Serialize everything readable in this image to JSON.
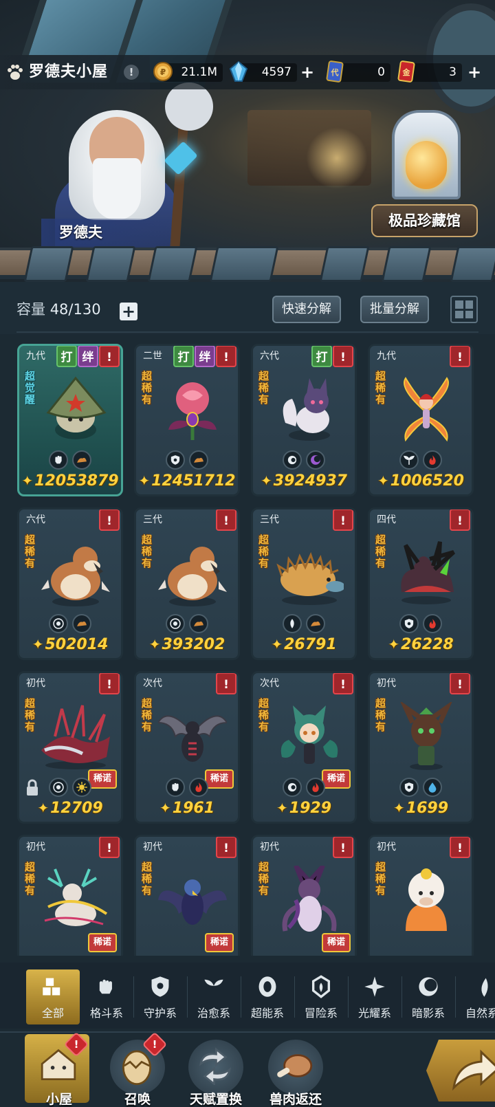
{
  "header": {
    "title": "罗德夫小屋",
    "info_label": "!",
    "npc_name": "罗德夫",
    "gallery_button": "极品珍藏馆"
  },
  "resources": [
    {
      "name": "coin-icon",
      "value": "21.1M",
      "has_plus": false,
      "color": "#e3a53a"
    },
    {
      "name": "crystal-icon",
      "value": "4597",
      "has_plus": true,
      "color": "#4fb3e8"
    },
    {
      "name": "ticket-card-icon",
      "value": "0",
      "has_plus": false,
      "color": "#3a5fc8"
    },
    {
      "name": "gold-card-icon",
      "value": "3",
      "has_plus": true,
      "color": "#c8262b"
    }
  ],
  "toolbar": {
    "capacity_label": "容量",
    "capacity_value": "48/130",
    "add_label": "+",
    "quick_decompose": "快速分解",
    "batch_decompose": "批量分解"
  },
  "monsters": [
    {
      "gen": "九代",
      "rarity": "超觉醒",
      "awake": true,
      "tags": [
        "打",
        "绊",
        "!"
      ],
      "elements": [
        "fist-icon",
        "earth-icon"
      ],
      "power": "12053879",
      "sprite": "mushroom-wizard",
      "color": "#7c8c5e"
    },
    {
      "gen": "二世",
      "rarity": "超稀有",
      "awake": false,
      "tags": [
        "打",
        "绊",
        "!"
      ],
      "elements": [
        "shield-icon",
        "earth-icon"
      ],
      "power": "12451712",
      "sprite": "rose",
      "color": "#e0607e"
    },
    {
      "gen": "六代",
      "rarity": "超稀有",
      "awake": false,
      "tags": [
        "打",
        "!"
      ],
      "elements": [
        "eye-icon",
        "moon-icon"
      ],
      "power": "3924937",
      "sprite": "fox",
      "color": "#5a4a7a"
    },
    {
      "gen": "九代",
      "rarity": "超稀有",
      "awake": false,
      "tags": [
        "!"
      ],
      "elements": [
        "leaf-icon",
        "fire-icon"
      ],
      "power": "1006520",
      "sprite": "fairy",
      "color": "#f0843a"
    },
    {
      "gen": "六代",
      "rarity": "超稀有",
      "awake": false,
      "tags": [
        "!"
      ],
      "elements": [
        "target-icon",
        "earth-icon"
      ],
      "power": "502014",
      "sprite": "mole",
      "color": "#c27a46"
    },
    {
      "gen": "三代",
      "rarity": "超稀有",
      "awake": false,
      "tags": [
        "!"
      ],
      "elements": [
        "target-icon",
        "earth-icon"
      ],
      "power": "393202",
      "sprite": "mole",
      "color": "#c27a46"
    },
    {
      "gen": "三代",
      "rarity": "超稀有",
      "awake": false,
      "tags": [
        "!"
      ],
      "elements": [
        "wind-icon",
        "earth-icon"
      ],
      "power": "26791",
      "sprite": "echidna",
      "color": "#d9a150"
    },
    {
      "gen": "四代",
      "rarity": "超稀有",
      "awake": false,
      "tags": [
        "!"
      ],
      "elements": [
        "shield-icon",
        "fire-icon"
      ],
      "power": "26228",
      "sprite": "beast",
      "color": "#4a2e3a"
    },
    {
      "gen": "初代",
      "rarity": "超稀有",
      "awake": false,
      "tags": [
        "!"
      ],
      "elements": [
        "target-icon",
        "sun-icon"
      ],
      "power": "12709",
      "sprite": "dragon",
      "color": "#8a2a3a",
      "locked": true
    },
    {
      "gen": "次代",
      "rarity": "超稀有",
      "awake": false,
      "tags": [
        "!"
      ],
      "elements": [
        "fist-icon",
        "fire-icon"
      ],
      "power": "1961",
      "sprite": "bat-dragon",
      "color": "#6a6a78"
    },
    {
      "gen": "次代",
      "rarity": "超稀有",
      "awake": false,
      "tags": [
        "!"
      ],
      "elements": [
        "eye-icon",
        "fire-icon"
      ],
      "power": "1929",
      "sprite": "cat-girl",
      "color": "#3a8a7a"
    },
    {
      "gen": "初代",
      "rarity": "超稀有",
      "awake": false,
      "tags": [
        "!"
      ],
      "elements": [
        "shield-icon",
        "water-icon"
      ],
      "power": "1699",
      "sprite": "treant",
      "color": "#5a3a2a"
    },
    {
      "gen": "初代",
      "rarity": "超稀有",
      "awake": false,
      "tags": [
        "!"
      ],
      "elements": [],
      "power": "",
      "sprite": "deer",
      "color": "#e8e0d8"
    },
    {
      "gen": "初代",
      "rarity": "超稀有",
      "awake": false,
      "tags": [
        "!"
      ],
      "elements": [],
      "power": "",
      "sprite": "raven",
      "color": "#3a3a6a"
    },
    {
      "gen": "初代",
      "rarity": "超稀有",
      "awake": false,
      "tags": [
        "!"
      ],
      "elements": [],
      "power": "",
      "sprite": "demon",
      "color": "#6a4a7a"
    },
    {
      "gen": "初代",
      "rarity": "超稀有",
      "awake": false,
      "tags": [
        "!"
      ],
      "elements": [],
      "power": "",
      "sprite": "pudding",
      "color": "#f08a3a"
    }
  ],
  "filters": [
    {
      "label": "全部",
      "icon": "all-icon",
      "active": true
    },
    {
      "label": "格斗系",
      "icon": "fist-icon",
      "active": false
    },
    {
      "label": "守护系",
      "icon": "shield-icon",
      "active": false
    },
    {
      "label": "治愈系",
      "icon": "sprout-icon",
      "active": false
    },
    {
      "label": "超能系",
      "icon": "psychic-icon",
      "active": false
    },
    {
      "label": "冒险系",
      "icon": "adventure-icon",
      "active": false
    },
    {
      "label": "光耀系",
      "icon": "light-icon",
      "active": false
    },
    {
      "label": "暗影系",
      "icon": "shadow-icon",
      "active": false
    },
    {
      "label": "自然系",
      "icon": "nature-icon",
      "active": false
    }
  ],
  "nav": [
    {
      "label": "小屋",
      "icon": "house-icon",
      "active": true,
      "badge": "!"
    },
    {
      "label": "召唤",
      "icon": "egg-icon",
      "active": false,
      "badge": "!"
    },
    {
      "label": "天赋置换",
      "icon": "swap-icon",
      "active": false,
      "badge": ""
    },
    {
      "label": "兽肉返还",
      "icon": "meat-icon",
      "active": false,
      "badge": ""
    }
  ],
  "special_tag": "稀诺"
}
